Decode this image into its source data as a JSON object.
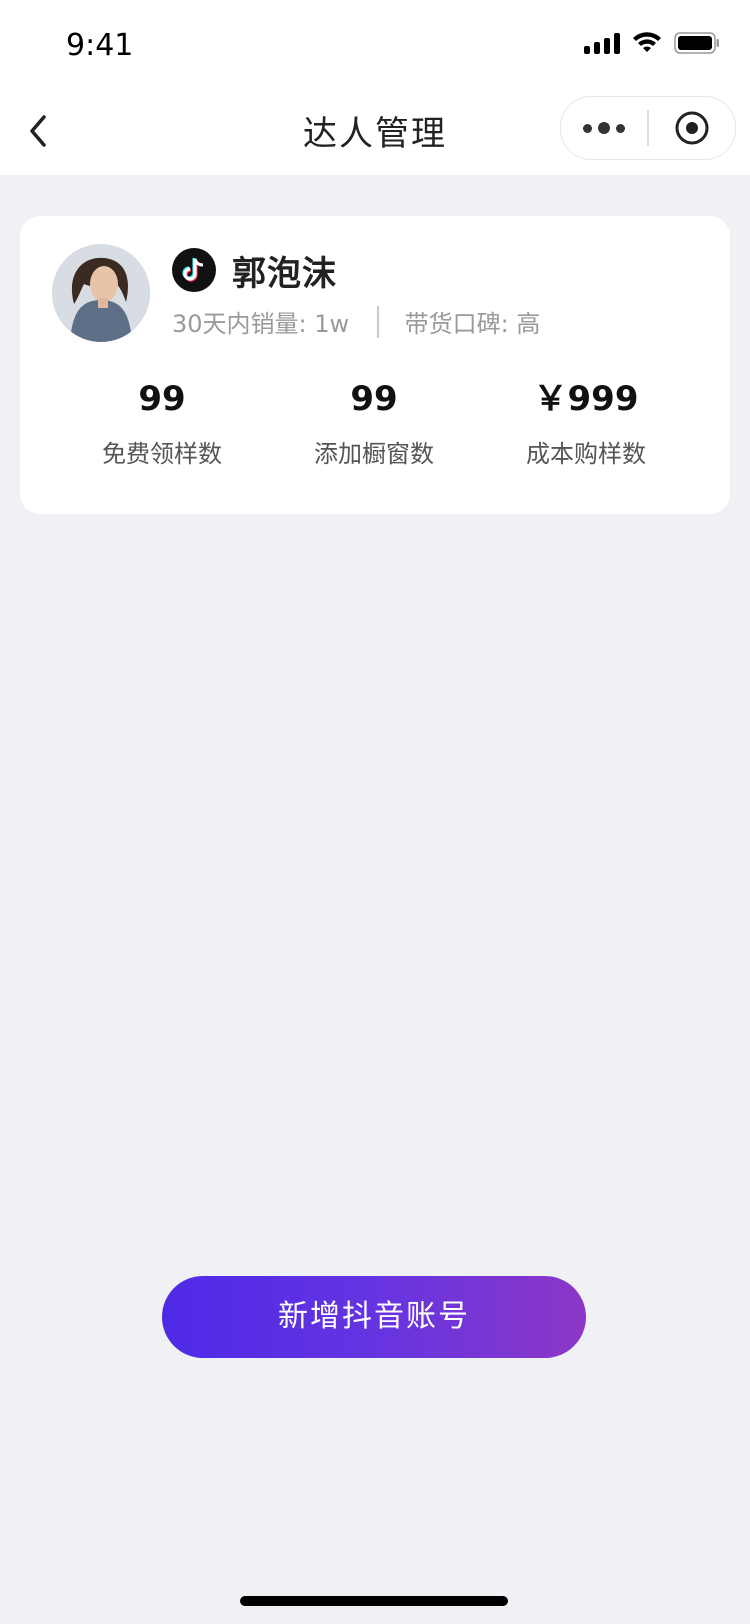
{
  "status_bar": {
    "time": "9:41"
  },
  "nav": {
    "title": "达人管理"
  },
  "profile": {
    "name": "郭泡沫",
    "sales_30d": "30天内销量: 1w",
    "reputation": "带货口碑: 高"
  },
  "stats": [
    {
      "value": "99",
      "label": "免费领样数"
    },
    {
      "value": "99",
      "label": "添加橱窗数"
    },
    {
      "value": "￥999",
      "label": "成本购样数"
    }
  ],
  "cta": {
    "label": "新增抖音账号"
  },
  "icons": {
    "back": "chevron-left-icon",
    "more": "more-dots-icon",
    "close": "record-circle-icon",
    "platform": "tiktok-icon"
  },
  "colors": {
    "background": "#F0F1F4",
    "cta_start": "#4E2AE7",
    "cta_end": "#8C37C6"
  }
}
